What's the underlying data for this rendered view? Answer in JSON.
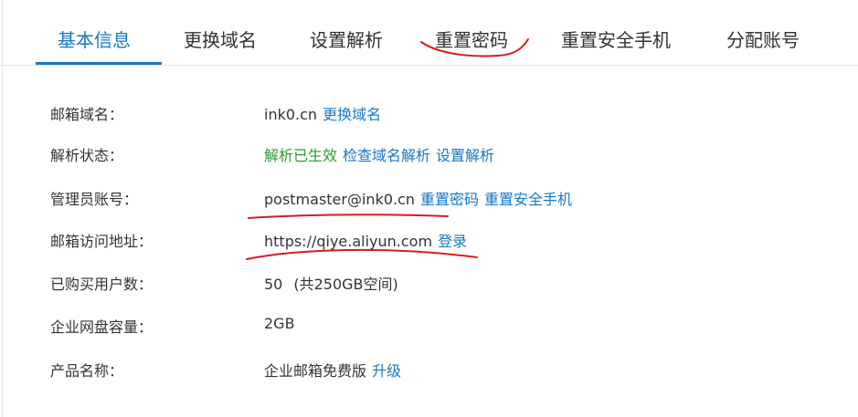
{
  "tabs": [
    {
      "label": "基本信息",
      "active": true
    },
    {
      "label": "更换域名",
      "active": false
    },
    {
      "label": "设置解析",
      "active": false
    },
    {
      "label": "重置密码",
      "active": false
    },
    {
      "label": "重置安全手机",
      "active": false
    },
    {
      "label": "分配账号",
      "active": false
    }
  ],
  "info": {
    "domain": {
      "label": "邮箱域名：",
      "value": "ink0.cn",
      "action": "更换域名"
    },
    "dns_status": {
      "label": "解析状态：",
      "status": "解析已生效",
      "actions": [
        "检查域名解析",
        "设置解析"
      ]
    },
    "admin": {
      "label": "管理员账号：",
      "value": "postmaster@ink0.cn",
      "actions": [
        "重置密码",
        "重置安全手机"
      ]
    },
    "access_url": {
      "label": "邮箱访问地址：",
      "value": "https://qiye.aliyun.com",
      "action": "登录"
    },
    "users": {
      "label": "已购买用户数：",
      "count": "50",
      "detail": "(共250GB空间)"
    },
    "disk": {
      "label": "企业网盘容量：",
      "value": "2GB"
    },
    "product": {
      "label": "产品名称：",
      "value": "企业邮箱免费版",
      "action": "升级"
    }
  },
  "colors": {
    "link": "#1677c8",
    "status_ok": "#2e9a2e",
    "annotation": "#d31e1e"
  }
}
